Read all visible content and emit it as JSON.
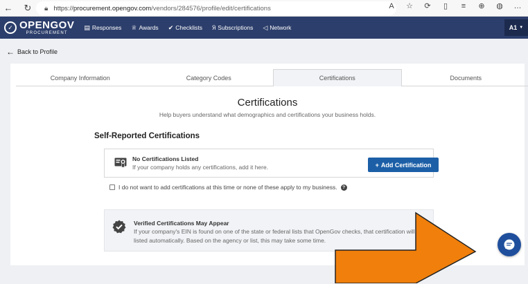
{
  "browser": {
    "url_prefix": "https://",
    "url_host": "procurement.opengov.com",
    "url_path": "/vendors/284576/profile/edit/certifications",
    "back_icon": "arrow-left-icon",
    "refresh_icon": "refresh-icon"
  },
  "navbar": {
    "logo_mark": "✓",
    "logo_main": "OPENGOV",
    "logo_sub": "PROCUREMENT",
    "items": [
      {
        "label": "Responses",
        "icon": "document-icon"
      },
      {
        "label": "Awards",
        "icon": "trophy-icon"
      },
      {
        "label": "Checklists",
        "icon": "check-icon"
      },
      {
        "label": "Subscriptions",
        "icon": "rss-icon"
      },
      {
        "label": "Network",
        "icon": "share-icon"
      }
    ],
    "user_initials": "A1",
    "bg_color": "#2c3e6b"
  },
  "back_link": "Back to Profile",
  "tabs": [
    {
      "label": "Company Information",
      "active": false
    },
    {
      "label": "Category Codes",
      "active": false
    },
    {
      "label": "Certifications",
      "active": true
    },
    {
      "label": "Documents",
      "active": false
    }
  ],
  "page": {
    "title": "Certifications",
    "subtitle": "Help buyers understand what demographics and certifications your business holds.",
    "section_heading": "Self-Reported Certifications"
  },
  "no_certs": {
    "title": "No Certifications Listed",
    "description": "If your company holds any certifications, add it here.",
    "add_button_label": "Add Certification",
    "button_color": "#1c5fa7"
  },
  "opt_out": {
    "label": "I do not want to add certifications at this time or none of these apply to my business.",
    "checked": false
  },
  "verified": {
    "title": "Verified Certifications May Appear",
    "description": "If your company's EIN is found on one of the state or federal lists that OpenGov checks, that certification will be listed automatically. Based on the agency or list, this may take some time."
  },
  "annotation": {
    "color": "#f07f0b"
  }
}
